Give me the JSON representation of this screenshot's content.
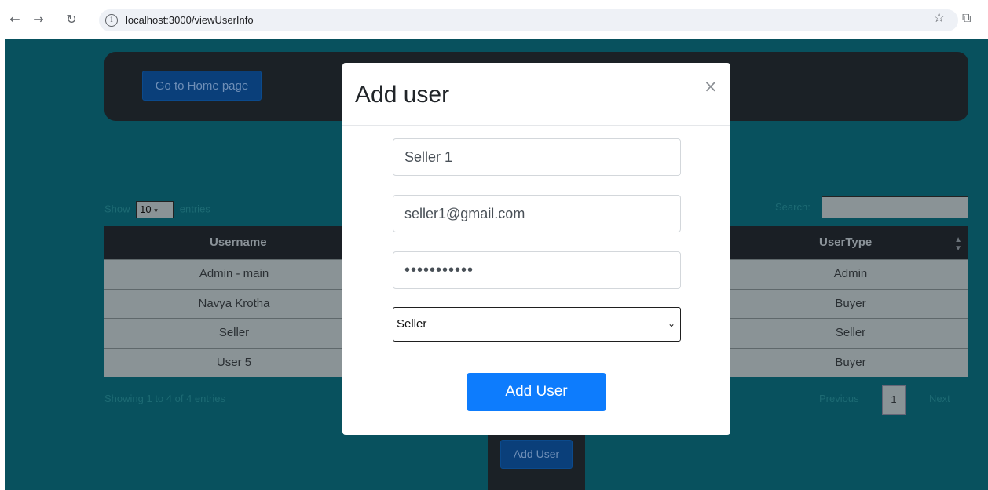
{
  "browser": {
    "url": "localhost:3000/viewUserInfo",
    "icons": {
      "back": "arrow-left-icon",
      "forward": "arrow-right-icon",
      "reload": "reload-icon",
      "info": "info-icon",
      "bookmark": "star-icon",
      "extensions": "puzzle-icon"
    }
  },
  "header": {
    "home_button": "Go to Home page"
  },
  "table": {
    "length_prefix": "Show",
    "length_value": "10",
    "length_suffix": "entries",
    "search_label": "Search:",
    "columns": [
      "Username",
      "UserType"
    ],
    "rows": [
      {
        "username": "Admin - main",
        "usertype": "Admin"
      },
      {
        "username": "Navya Krotha",
        "usertype": "Buyer"
      },
      {
        "username": "Seller",
        "usertype": "Seller"
      },
      {
        "username": "User 5",
        "usertype": "Buyer"
      }
    ],
    "info": "Showing 1 to 4 of 4 entries",
    "pagination": {
      "previous": "Previous",
      "current": "1",
      "next": "Next"
    }
  },
  "footer": {
    "add_user_button": "Add User"
  },
  "modal": {
    "title": "Add user",
    "close": "×",
    "name_value": "Seller 1",
    "email_value": "seller1@gmail.com",
    "password_value": "•••••••••••",
    "usertype_selected": "Seller",
    "submit": "Add User"
  },
  "colors": {
    "page_bg": "#08515e",
    "primary": "#0d7cfd",
    "dark_panel": "#1b2126"
  }
}
